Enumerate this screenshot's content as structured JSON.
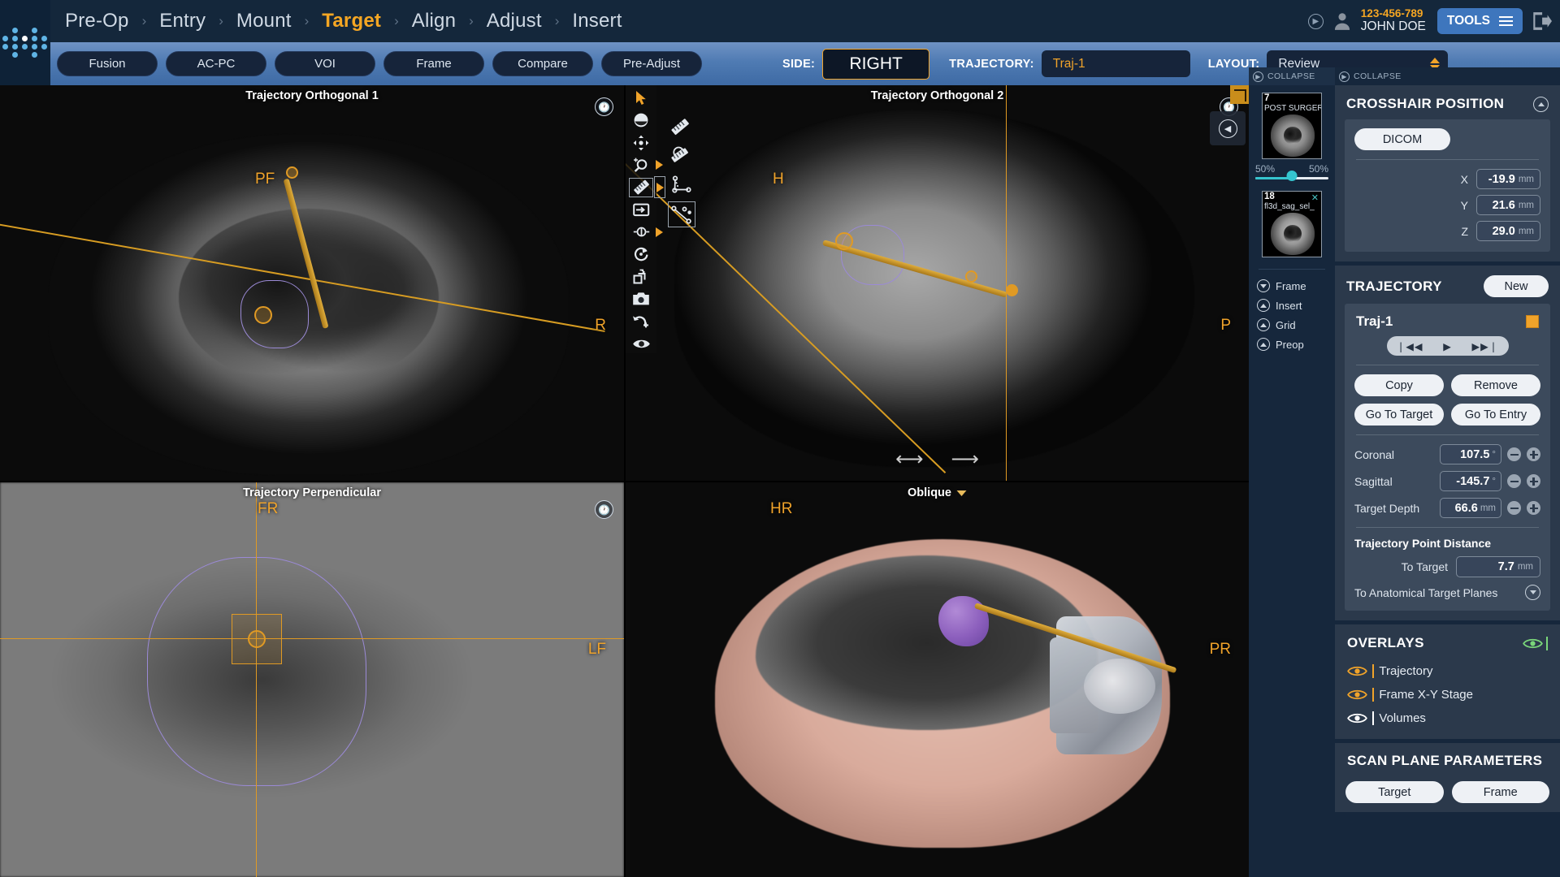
{
  "header": {
    "logo_name": "dot-matrix-logo",
    "breadcrumb": [
      {
        "label": "Pre-Op",
        "active": false
      },
      {
        "label": "Entry",
        "active": false
      },
      {
        "label": "Mount",
        "active": false
      },
      {
        "label": "Target",
        "active": true
      },
      {
        "label": "Align",
        "active": false
      },
      {
        "label": "Adjust",
        "active": false
      },
      {
        "label": "Insert",
        "active": false
      }
    ],
    "separator": "›",
    "user": {
      "id": "123-456-789",
      "name": "JOHN DOE"
    },
    "tools_label": "TOOLS"
  },
  "subheader": {
    "buttons": [
      "Fusion",
      "AC-PC",
      "VOI",
      "Frame",
      "Compare",
      "Pre-Adjust"
    ],
    "side_label": "SIDE:",
    "side_value": "RIGHT",
    "trajectory_label": "TRAJECTORY:",
    "trajectory_value": "Traj-1",
    "layout_label": "LAYOUT:",
    "layout_value": "Review"
  },
  "viewports": {
    "top_left": {
      "title": "Trajectory Orthogonal 1",
      "orient_top": "PF",
      "orient_right": "R"
    },
    "top_right": {
      "title": "Trajectory Orthogonal 2",
      "orient_top": "H",
      "orient_right": "P"
    },
    "bottom_left": {
      "title": "Trajectory Perpendicular",
      "orient_top": "FR",
      "orient_right": "LF"
    },
    "bottom_right": {
      "title": "Oblique",
      "orient_top": "HR",
      "orient_right": "PR"
    }
  },
  "thumb_panel": {
    "collapse_label": "COLLAPSE",
    "thumbnails": [
      {
        "number": "7",
        "name": "POST SURGER",
        "closable": false
      },
      {
        "number": "18",
        "name": "fl3d_sag_sel_",
        "closable": true
      }
    ],
    "blend_left": "50%",
    "blend_right": "50%",
    "items": [
      {
        "label": "Frame",
        "state": "collapsed"
      },
      {
        "label": "Insert",
        "state": "expanded"
      },
      {
        "label": "Grid",
        "state": "expanded"
      },
      {
        "label": "Preop",
        "state": "expanded"
      }
    ]
  },
  "sidebar": {
    "collapse_label": "COLLAPSE",
    "crosshair": {
      "title": "CROSSHAIR POSITION",
      "mode_button": "DICOM",
      "coords": [
        {
          "axis": "X",
          "value": "-19.9",
          "unit": "mm"
        },
        {
          "axis": "Y",
          "value": "21.6",
          "unit": "mm"
        },
        {
          "axis": "Z",
          "value": "29.0",
          "unit": "mm"
        }
      ]
    },
    "trajectory": {
      "title": "TRAJECTORY",
      "new_button": "New",
      "name": "Traj-1",
      "color": "#f0a32a",
      "transport": [
        "❘◀◀",
        "▶",
        "▶▶❘"
      ],
      "copy_button": "Copy",
      "remove_button": "Remove",
      "go_to_target_button": "Go To Target",
      "go_to_entry_button": "Go To Entry",
      "params": [
        {
          "label": "Coronal",
          "value": "107.5",
          "unit": "°"
        },
        {
          "label": "Sagittal",
          "value": "-145.7",
          "unit": "°"
        },
        {
          "label": "Target Depth",
          "value": "66.6",
          "unit": "mm"
        }
      ],
      "distance_title": "Trajectory Point Distance",
      "to_target_label": "To Target",
      "to_target_value": "7.7",
      "to_target_unit": "mm",
      "anatomical_label": "To Anatomical Target Planes"
    },
    "overlays": {
      "title": "OVERLAYS",
      "master_color": "#7ad67a",
      "items": [
        {
          "label": "Trajectory",
          "color": "#f0a32a",
          "visible": true
        },
        {
          "label": "Frame X-Y Stage",
          "color": "#f0a32a",
          "visible": true
        },
        {
          "label": "Volumes",
          "color": "#ffffff",
          "visible": true
        }
      ]
    },
    "scan_plane": {
      "title": "SCAN PLANE PARAMETERS",
      "buttons": [
        "Target",
        "Frame"
      ]
    }
  },
  "tool_palette": {
    "tools": [
      "cursor-icon",
      "window-level-icon",
      "pan-icon",
      "zoom-icon",
      "ruler-icon",
      "slab-icon",
      "contrast-icon",
      "rotate-icon",
      "copy-slice-icon",
      "camera-icon",
      "undo-add-icon",
      "eye-icon"
    ],
    "flyout_tools": [
      "ruler-straight-icon",
      "angle-protractor-icon",
      "angle-three-point-icon",
      "point-distance-icon"
    ]
  },
  "colors": {
    "accent_orange": "#f0a32a",
    "header_bg": "#14273b",
    "panel_bg": "#2b394b",
    "inner_bg": "#3c4a5c",
    "blue_button": "#3e76bd"
  }
}
